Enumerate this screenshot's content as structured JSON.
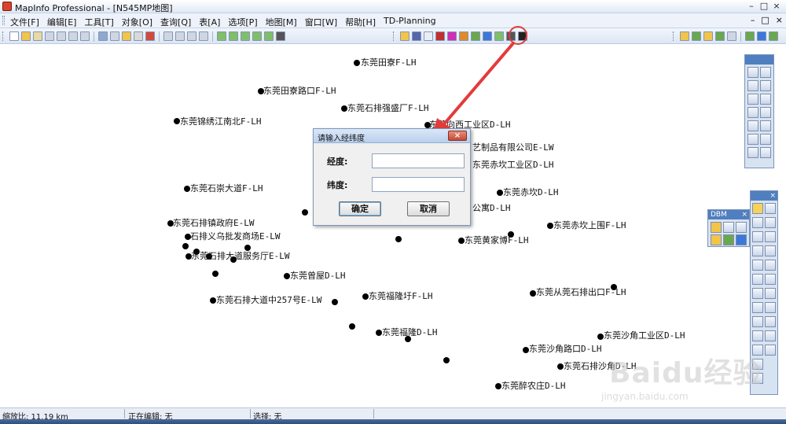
{
  "window": {
    "title": "MapInfo Professional - [N545MP地图]",
    "minimize_label": "–",
    "maximize_label": "□",
    "close_label": "×"
  },
  "menu": {
    "items": [
      "文件[F]",
      "编辑[E]",
      "工具[T]",
      "对象[O]",
      "查询[Q]",
      "表[A]",
      "选项[P]",
      "地图[M]",
      "窗口[W]",
      "帮助[H]",
      "TD-Planning"
    ],
    "controls": [
      "–",
      "□",
      "×"
    ]
  },
  "dialog": {
    "title": "请输入经纬度",
    "close_label": "×",
    "longitude_label": "经度:",
    "latitude_label": "纬度:",
    "longitude_value": "",
    "latitude_value": "",
    "ok_label": "确定",
    "cancel_label": "取消"
  },
  "map": {
    "labels": [
      "东莞田寮F-LH",
      "东莞田寮路口F-LH",
      "东莞石排强盛厂F-LH",
      "东莞锦绣江南北F-LH",
      "东莞向西工业区D-LH",
      "艺制品有限公司E-LW",
      "东莞赤坎工业区D-LH",
      "东莞石崇大道F-LH",
      "东莞赤坎D-LH",
      "公寓D-LH",
      "东莞石排镇政府E-LW",
      "东莞赤坎上围F-LH",
      "石排义乌批发商场E-LW",
      "东莞黄家博F-LH",
      "东莞石排大道服务厅E-LW",
      "东莞曾屋D-LH",
      "东莞从莞石排出口F-LH",
      "东莞石排大道中257号E-LW",
      "东莞福隆圩F-LH",
      "东莞福隆D-LH",
      "东莞沙角工业区D-LH",
      "东莞沙角路口D-LH",
      "东莞石排沙角D-LH",
      "东莞醉农庄D-LH"
    ]
  },
  "palettes": {
    "dbm_title": "DBM"
  },
  "status": {
    "scale": "缩放比: 11.19 km",
    "editing": "正在编辑: 无",
    "selection": "选择: 无"
  },
  "watermark": {
    "brand": "Baidu经验",
    "url": "jingyan.baidu.com"
  },
  "colors": {
    "annotation_red": "#e33b3b",
    "title_blue": "#4f7fbf"
  }
}
